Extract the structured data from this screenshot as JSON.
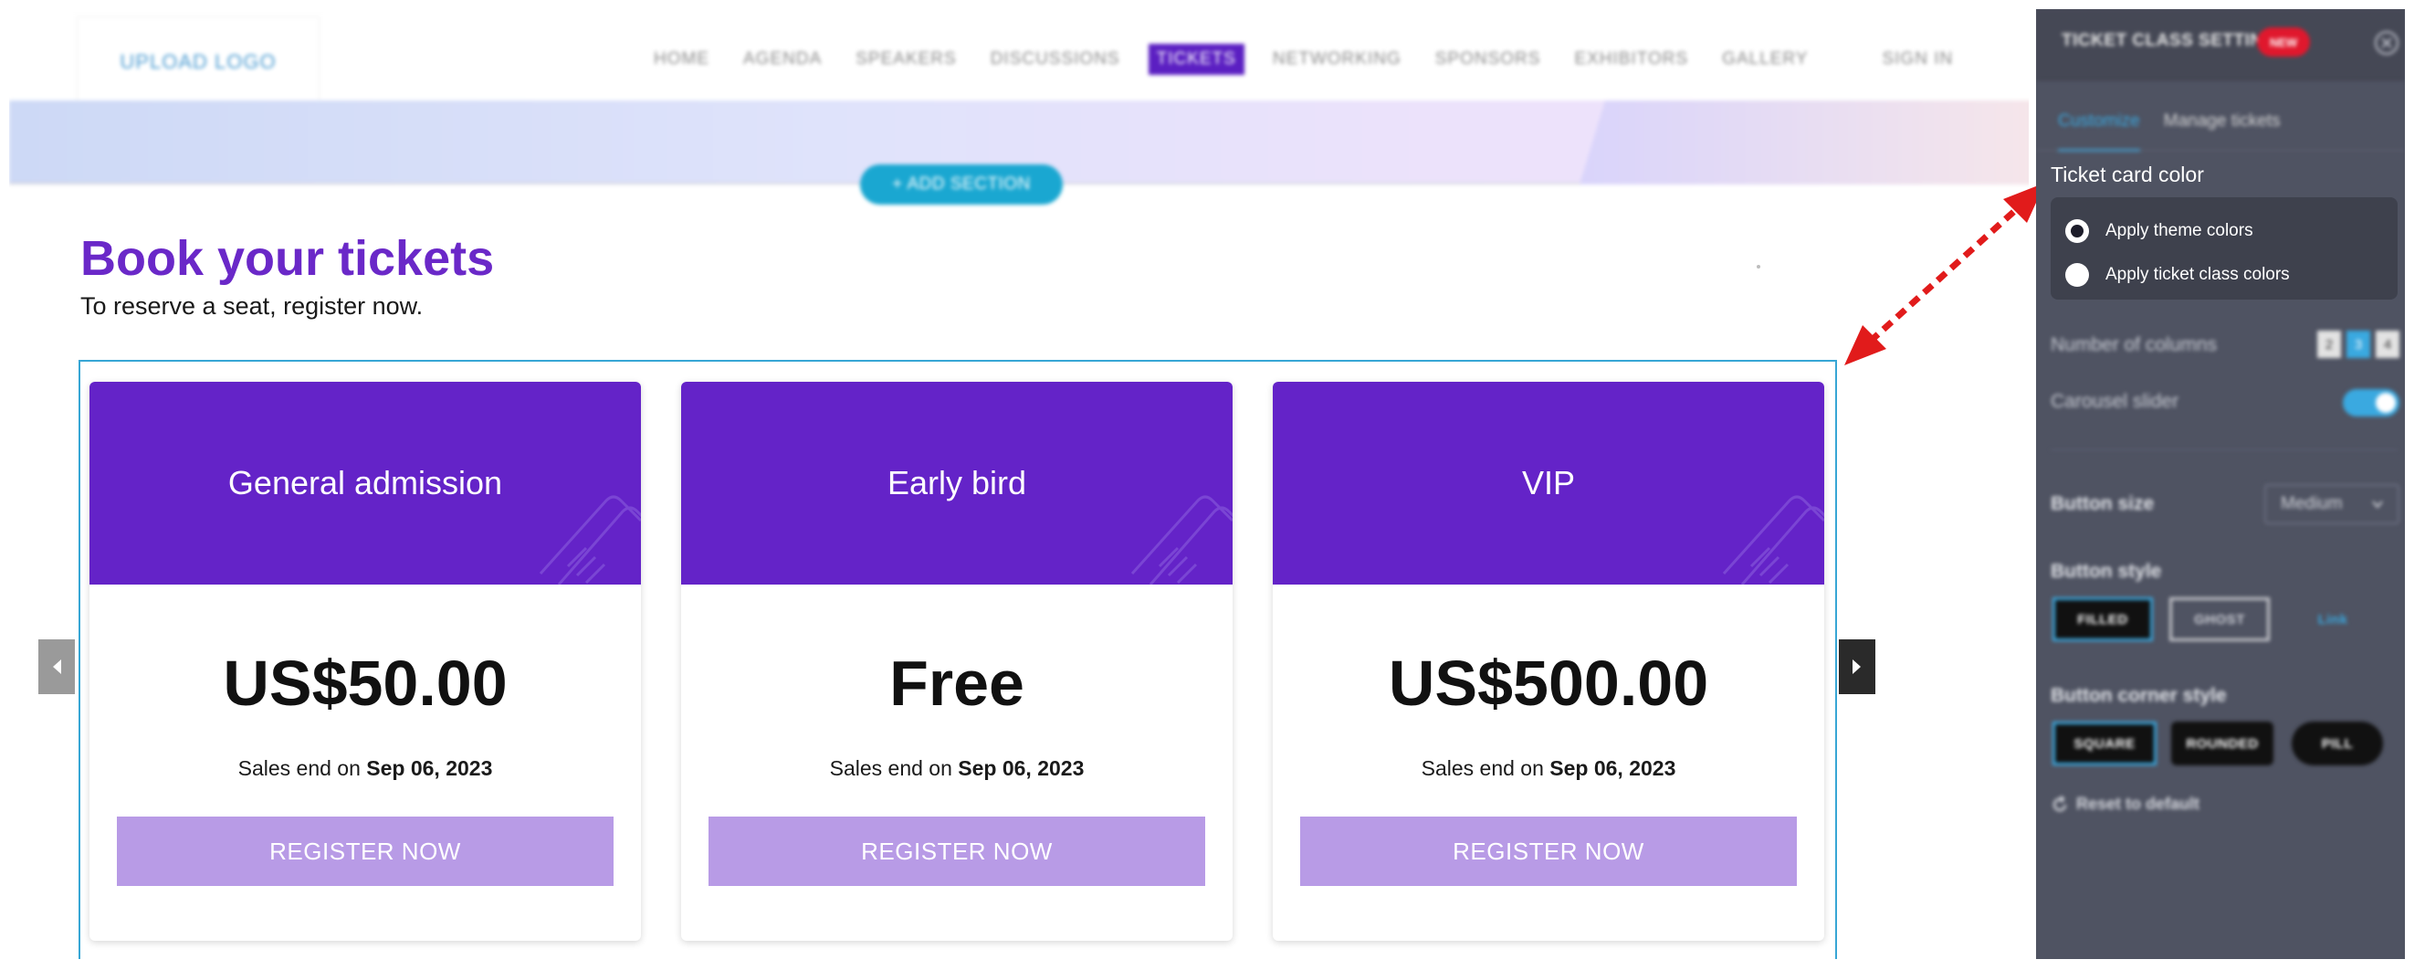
{
  "site": {
    "logo_text": "UPLOAD LOGO",
    "nav": [
      {
        "label": "HOME",
        "active": false
      },
      {
        "label": "AGENDA",
        "active": false
      },
      {
        "label": "SPEAKERS",
        "active": false
      },
      {
        "label": "DISCUSSIONS",
        "active": false
      },
      {
        "label": "TICKETS",
        "active": true
      },
      {
        "label": "NETWORKING",
        "active": false
      },
      {
        "label": "SPONSORS",
        "active": false
      },
      {
        "label": "EXHIBITORS",
        "active": false
      },
      {
        "label": "GALLERY",
        "active": false
      }
    ],
    "sign_in": "SIGN IN",
    "add_section": "+ ADD SECTION"
  },
  "tickets_section": {
    "heading": "Book your tickets",
    "subheading": "To reserve a seat, register now.",
    "sales_prefix": "Sales end on",
    "cards": [
      {
        "title": "General admission",
        "price": "US$50.00",
        "sales_date": "Sep 06, 2023",
        "button": "REGISTER NOW"
      },
      {
        "title": "Early bird",
        "price": "Free",
        "sales_date": "Sep 06, 2023",
        "button": "REGISTER NOW"
      },
      {
        "title": "VIP",
        "price": "US$500.00",
        "sales_date": "Sep 06, 2023",
        "button": "REGISTER NOW"
      }
    ]
  },
  "panel": {
    "title": "TICKET CLASS SETTINGS",
    "badge": "NEW",
    "tabs": [
      {
        "label": "Customize",
        "active": true
      },
      {
        "label": "Manage tickets",
        "active": false
      }
    ],
    "card_color_label": "Ticket card color",
    "card_color_options": [
      {
        "label": "Apply theme colors",
        "checked": true
      },
      {
        "label": "Apply ticket class colors",
        "checked": false
      }
    ],
    "columns_label": "Number of columns",
    "columns_options": [
      "2",
      "3",
      "4"
    ],
    "columns_selected": "3",
    "carousel_label": "Carousel slider",
    "carousel_on": true,
    "button_size_label": "Button size",
    "button_size_value": "Medium",
    "button_style_label": "Button style",
    "button_style_filled": "FILLED",
    "button_style_ghost": "GHOST",
    "button_style_link": "Link",
    "corner_style_label": "Button corner style",
    "corner_square": "SQUARE",
    "corner_rounded": "ROUNDED",
    "corner_pill": "PILL",
    "reset_label": "Reset to default"
  },
  "colors": {
    "brand_purple": "#6423c8",
    "heading_purple": "#6a28c8",
    "button_lavender": "#b89be6",
    "accent_blue": "#3aa9e0",
    "panel_bg": "#4f5362",
    "annotation_red": "#e11b1b"
  }
}
